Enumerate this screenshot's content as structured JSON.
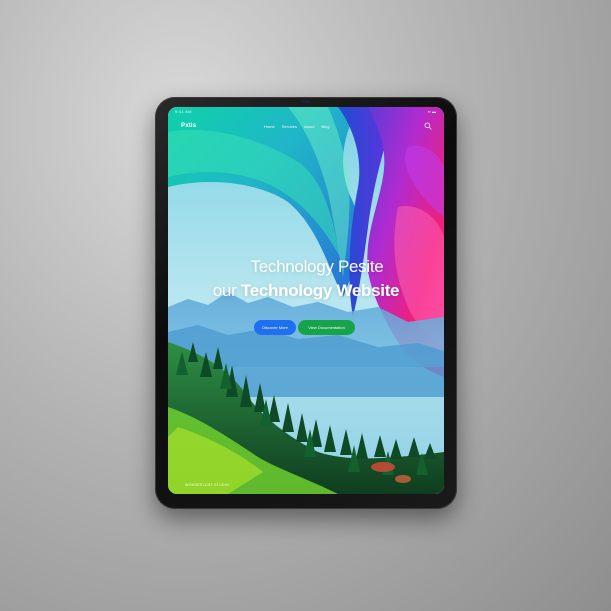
{
  "status_bar": {
    "time": "9:41 AM",
    "indicators": "▪▪ ▬"
  },
  "nav": {
    "logo": "Pxtis",
    "links": [
      "Home",
      "Services",
      "About",
      "Blog"
    ]
  },
  "hero": {
    "line1": "Technology Pesite",
    "line2_prefix": "our",
    "line2_bold": "Technology Website"
  },
  "cta": {
    "primary_label": "Discover More",
    "secondary_label": "View Documentation"
  },
  "footer": {
    "label": "WONDERLUST STUDIO"
  },
  "colors": {
    "primary_button": "#1f6ff0",
    "secondary_button": "#16a34a",
    "teal_wave": "#22c7b8",
    "magenta_wave": "#e11d74",
    "forest": "#1e7a3c"
  }
}
